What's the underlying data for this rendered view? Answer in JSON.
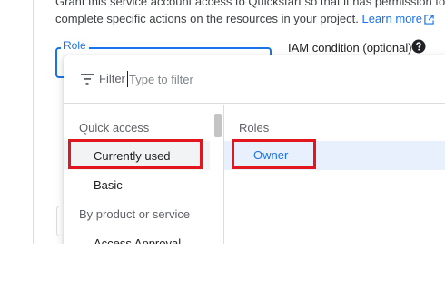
{
  "description": {
    "line1": "Grant this service account access to Quickstart so that it has permission to",
    "line2": "complete specific actions on the resources in your project.",
    "learn_more": "Learn more"
  },
  "role_field": {
    "label": "Role"
  },
  "iam_condition": {
    "label": "IAM condition (optional)"
  },
  "dropdown": {
    "filter_label": "Filter",
    "filter_placeholder": "Type to filter",
    "left": {
      "quick_access_heading": "Quick access",
      "currently_used": "Currently used",
      "basic": "Basic",
      "by_product_heading": "By product or service",
      "access_approval": "Access Approval"
    },
    "right": {
      "roles_heading": "Roles",
      "owner": "Owner"
    }
  },
  "colors": {
    "accent": "#1a73e8",
    "highlight": "#e3151f",
    "selected_bg": "#e8f0fe"
  },
  "icons": [
    "external-link-icon",
    "help-icon",
    "filter-icon"
  ]
}
